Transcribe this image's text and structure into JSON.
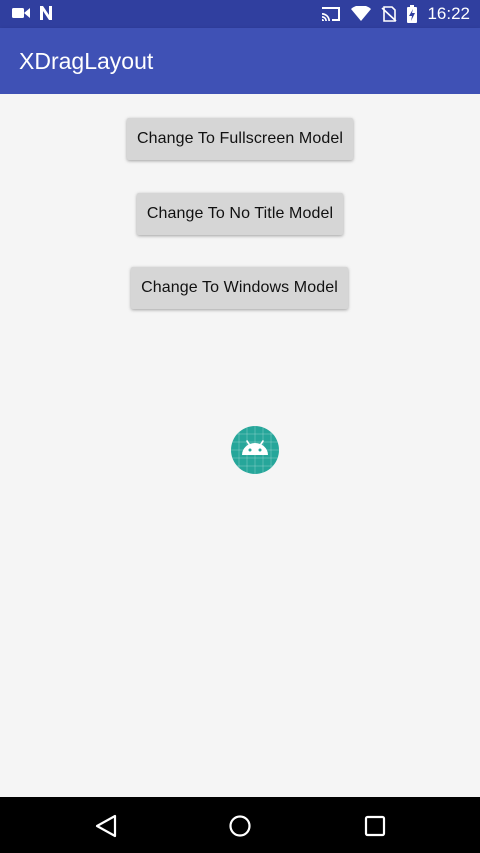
{
  "status_bar": {
    "time": "16:22",
    "left_icons": [
      "video-camera-icon",
      "n-icon"
    ],
    "right_icons": [
      "cast-icon",
      "wifi-icon",
      "no-sim-icon",
      "battery-charging-icon"
    ]
  },
  "app_bar": {
    "title": "XDragLayout",
    "color": "#3f51b5"
  },
  "main": {
    "buttons": [
      {
        "label": "Change To Fullscreen Model"
      },
      {
        "label": "Change To No Title Model"
      },
      {
        "label": "Change To Windows Model"
      }
    ],
    "floating_icon": "android-launcher-icon"
  },
  "nav_bar": {
    "icons": [
      "back-icon",
      "home-icon",
      "recent-apps-icon"
    ]
  },
  "colors": {
    "status_bar": "#303f9f",
    "primary": "#3f51b5",
    "background": "#f5f5f5",
    "button": "#d6d6d6",
    "fab": "#26a69a"
  }
}
